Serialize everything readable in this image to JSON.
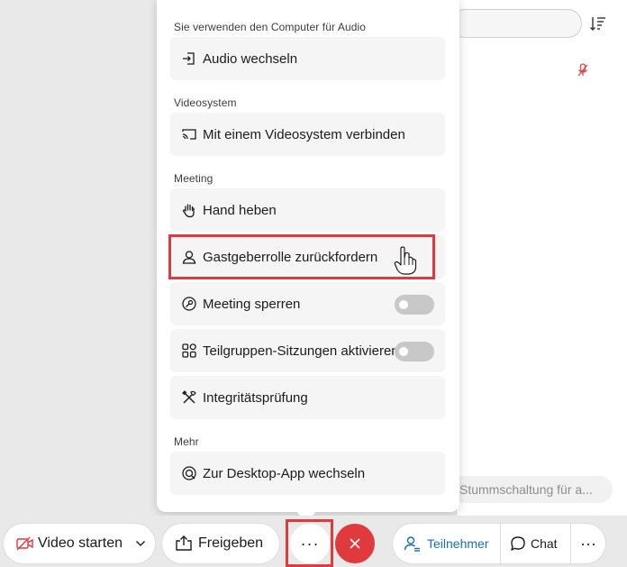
{
  "menu": {
    "section_audio": "Sie verwenden den Computer für Audio",
    "audio_switch": "Audio wechseln",
    "section_video": "Videosystem",
    "video_connect": "Mit einem Videosystem verbinden",
    "section_meeting": "Meeting",
    "raise_hand": "Hand heben",
    "reclaim_host": "Gastgeberrolle zurückfordern",
    "lock_meeting": "Meeting sperren",
    "lock_meeting_on": false,
    "breakout": "Teilgruppen-Sitzungen aktivieren",
    "breakout_on": false,
    "health_check": "Integritätsprüfung",
    "section_more": "Mehr",
    "desktop_app": "Zur Desktop-App wechseln"
  },
  "side": {
    "chat_placeholder": "Stummschaltung für a..."
  },
  "toolbar": {
    "video_label": "Video starten",
    "share_label": "Freigeben",
    "more_label": "···",
    "participants_label": "Teilnehmer",
    "chat_label": "Chat",
    "overflow_label": "···"
  },
  "colors": {
    "accent_red": "#e0393e",
    "link_blue": "#1a6fb6"
  }
}
